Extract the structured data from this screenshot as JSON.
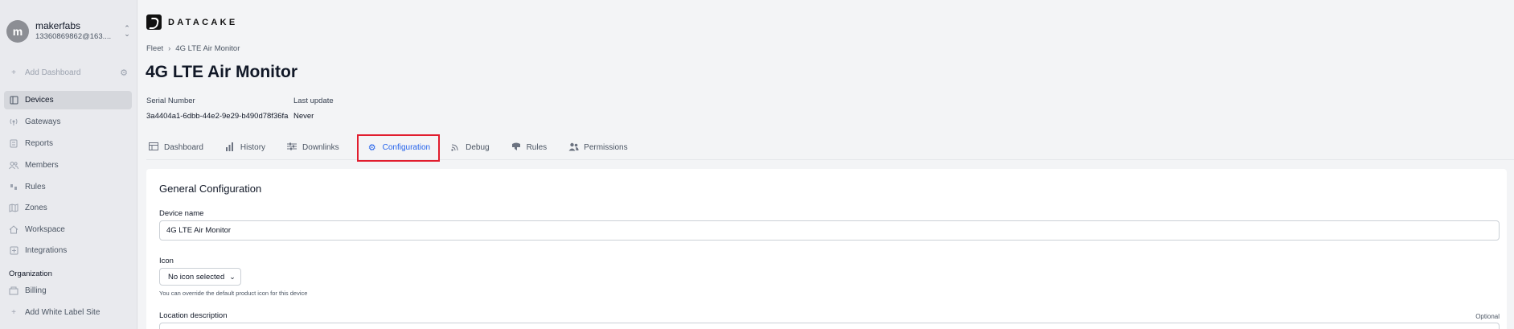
{
  "account": {
    "initial": "m",
    "name": "makerfabs",
    "email": "13360869862@163...."
  },
  "sidebar": {
    "add_dashboard": "Add Dashboard",
    "items": [
      {
        "label": "Devices",
        "icon": "devices-icon"
      },
      {
        "label": "Gateways",
        "icon": "gateway-icon"
      },
      {
        "label": "Reports",
        "icon": "report-icon"
      },
      {
        "label": "Members",
        "icon": "members-icon"
      },
      {
        "label": "Rules",
        "icon": "rules-icon"
      },
      {
        "label": "Zones",
        "icon": "zones-icon"
      },
      {
        "label": "Workspace",
        "icon": "home-icon"
      },
      {
        "label": "Integrations",
        "icon": "integrations-icon"
      }
    ],
    "organization_heading": "Organization",
    "billing": "Billing",
    "add_white_label": "Add White Label Site"
  },
  "brand": {
    "name": "DATACAKE"
  },
  "breadcrumb": {
    "root": "Fleet",
    "current": "4G LTE Air Monitor"
  },
  "device": {
    "title": "4G LTE Air Monitor",
    "serial_label": "Serial Number",
    "serial_value": "3a4404a1-6dbb-44e2-9e29-b490d78f36fa",
    "update_label": "Last update",
    "update_value": "Never"
  },
  "tabs": [
    {
      "label": "Dashboard",
      "icon": "table-icon"
    },
    {
      "label": "History",
      "icon": "bar-chart-icon"
    },
    {
      "label": "Downlinks",
      "icon": "sliders-icon"
    },
    {
      "label": "Configuration",
      "icon": "gear-icon",
      "active": true
    },
    {
      "label": "Debug",
      "icon": "signal-icon"
    },
    {
      "label": "Rules",
      "icon": "rules-icon"
    },
    {
      "label": "Permissions",
      "icon": "users-icon"
    }
  ],
  "config": {
    "section_title": "General Configuration",
    "device_name_label": "Device name",
    "device_name_value": "4G LTE Air Monitor",
    "icon_label": "Icon",
    "icon_select_value": "No icon selected",
    "icon_hint": "You can override the default product icon for this device",
    "location_label": "Location description",
    "optional_label": "Optional"
  },
  "colors": {
    "accent": "#2563eb",
    "highlight": "#e11d2e",
    "sidebar_bg": "#e9eaee",
    "active_item_bg": "#d5d7dc"
  }
}
